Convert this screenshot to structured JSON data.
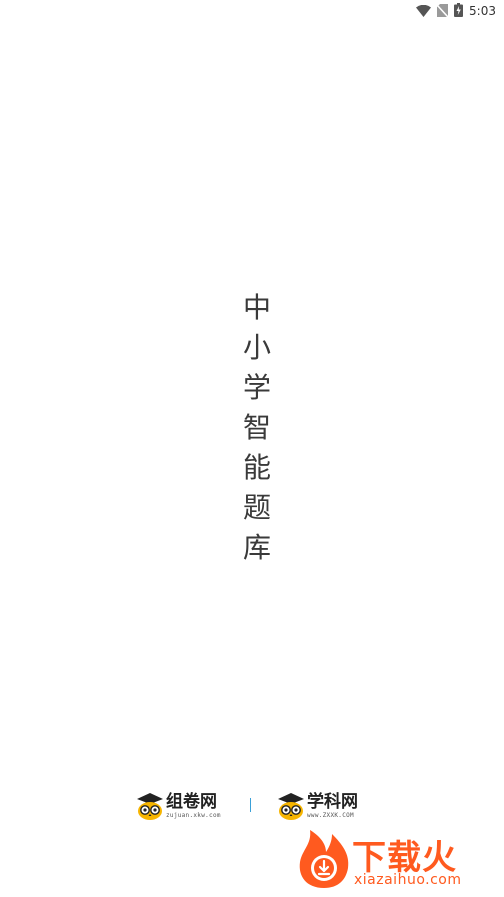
{
  "status_bar": {
    "time": "5:03",
    "icons": [
      "wifi-icon",
      "no-sim-icon",
      "battery-charging-icon"
    ]
  },
  "splash": {
    "title_chars": [
      "中",
      "小",
      "学",
      "智",
      "能",
      "题",
      "库"
    ]
  },
  "footer": {
    "brand_left": {
      "name": "组卷网",
      "url": "zujuan.xkw.com",
      "icon": "owl-graduate-logo"
    },
    "brand_right": {
      "name": "学科网",
      "url": "www.ZXXK.COM",
      "icon": "owl-graduate-logo"
    }
  },
  "watermark": {
    "text": "下载火",
    "url": "xiazaihuo.com",
    "icon": "flame-download-logo"
  },
  "colors": {
    "background": "#ffffff",
    "title_text": "#3a3a3a",
    "owl_yellow": "#f7b500",
    "divider": "#3aa0d8",
    "watermark_orange": "#ff5a1f"
  }
}
